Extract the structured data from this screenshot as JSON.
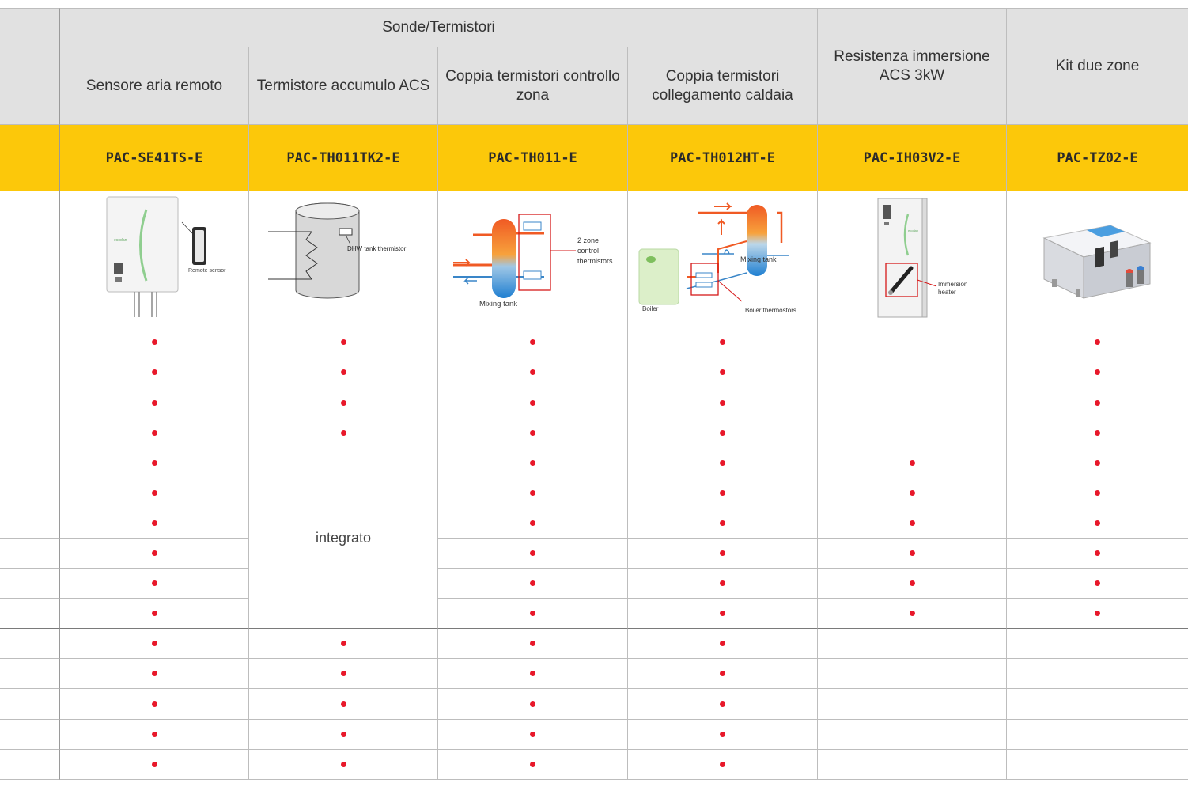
{
  "header": {
    "group_title": "Sonde/Termistori",
    "columns": [
      "Sensore aria remoto",
      "Termistore accumulo ACS",
      "Coppia termistori controllo zona",
      "Coppia termistori collegamento caldaia",
      "Resistenza immersione ACS 3kW",
      "Kit due zone"
    ]
  },
  "codes": [
    "PAC-SE41TS-E",
    "PAC-TH011TK2-E",
    "PAC-TH011-E",
    "PAC-TH012HT-E",
    "PAC-IH03V2-E",
    "PAC-TZ02-E"
  ],
  "images": {
    "remote_sensor_label": "Remote sensor",
    "dhw_label": "DHW tank thermistor",
    "zone_label_1": "2 zone",
    "zone_label_2": "control",
    "zone_label_3": "thermistors",
    "mixing_tank_label": "Mixing tank",
    "boiler_label": "Boiler",
    "boiler_thermistors_label": "Boiler thermostors",
    "immersion_label_1": "Immersion",
    "immersion_label_2": "heater",
    "brand_mark": "ecodan"
  },
  "integrated_text": "integrato",
  "colors": {
    "accent_yellow": "#fcc80a",
    "dot_red": "#e8182a",
    "header_gray": "#e1e1e1"
  },
  "compatibility": [
    [
      true,
      true,
      true,
      true,
      false,
      true
    ],
    [
      true,
      true,
      true,
      true,
      false,
      true
    ],
    [
      true,
      true,
      true,
      true,
      false,
      true
    ],
    [
      true,
      true,
      true,
      true,
      false,
      true
    ],
    [
      true,
      "integrated",
      true,
      true,
      true,
      true
    ],
    [
      true,
      "integrated",
      true,
      true,
      true,
      true
    ],
    [
      true,
      "integrated",
      true,
      true,
      true,
      true
    ],
    [
      true,
      "integrated",
      true,
      true,
      true,
      true
    ],
    [
      true,
      "integrated",
      true,
      true,
      true,
      true
    ],
    [
      true,
      "integrated",
      true,
      true,
      true,
      true
    ],
    [
      true,
      true,
      true,
      true,
      false,
      false
    ],
    [
      true,
      true,
      true,
      true,
      false,
      false
    ],
    [
      true,
      true,
      true,
      true,
      false,
      false
    ],
    [
      true,
      true,
      true,
      true,
      false,
      false
    ],
    [
      true,
      true,
      true,
      true,
      false,
      false
    ]
  ]
}
